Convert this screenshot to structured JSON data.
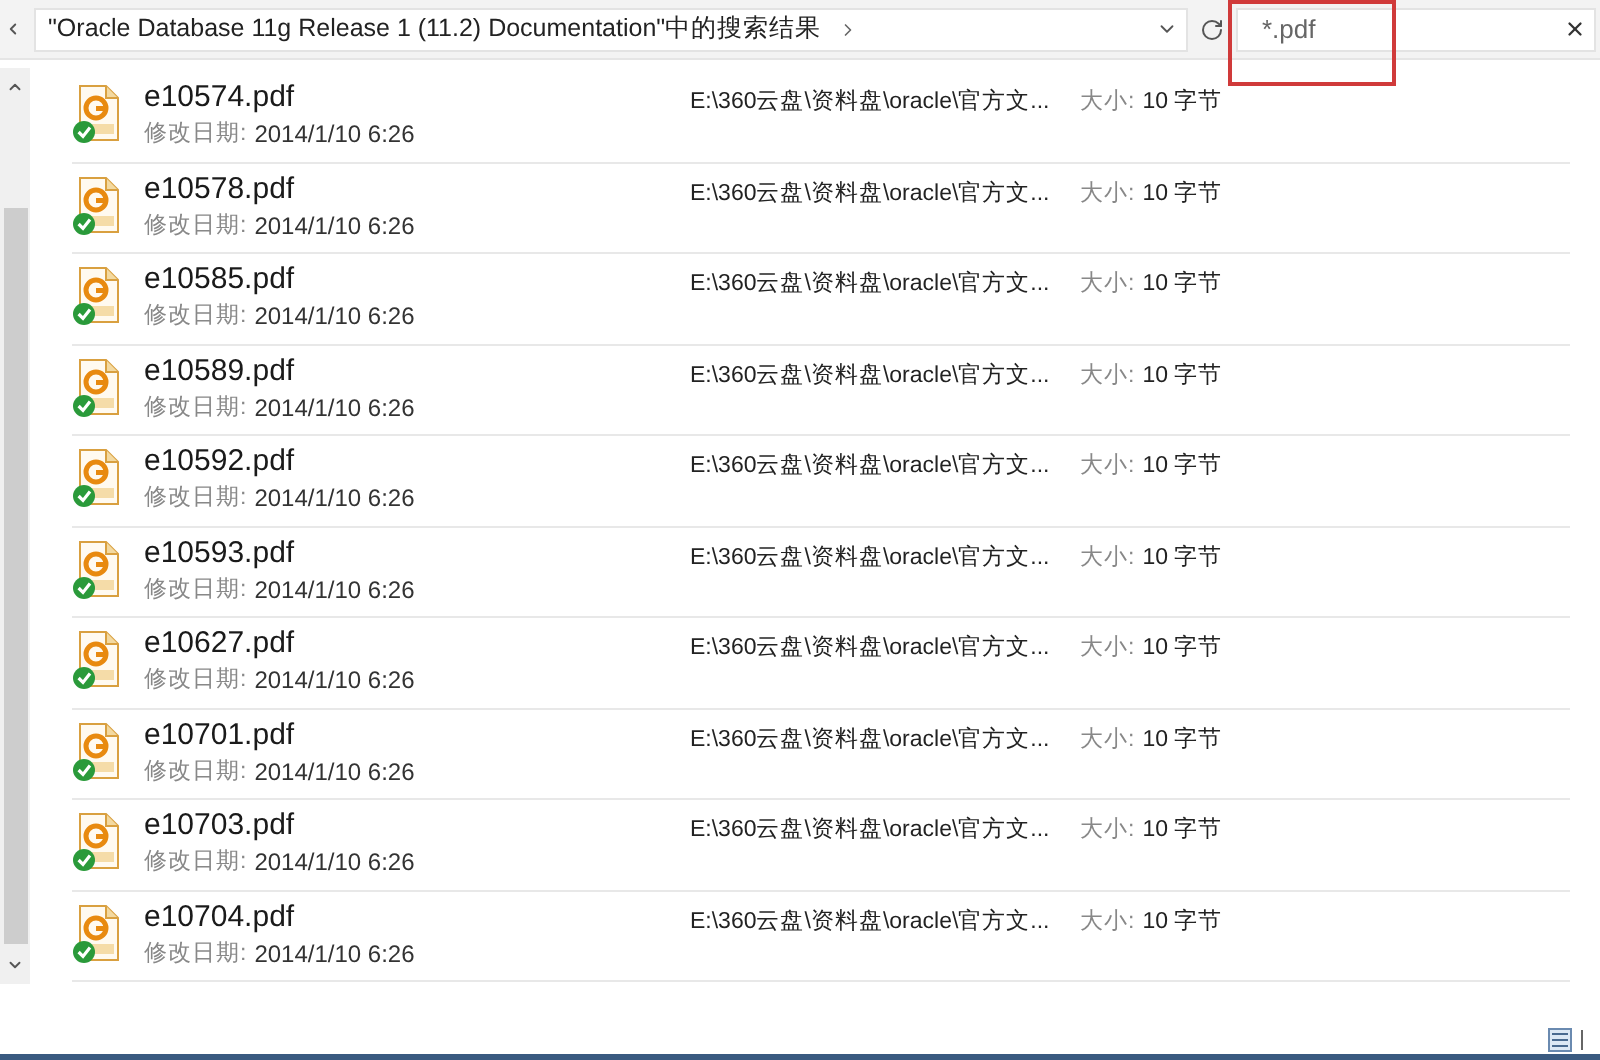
{
  "address_bar": {
    "path": "\"Oracle Database 11g Release 1 (11.2) Documentation\"中的搜索结果"
  },
  "search": {
    "value": "*.pdf",
    "highlighted": true
  },
  "files": [
    {
      "name": "e10574.pdf",
      "date_label": "修改日期:",
      "date": "2014/1/10 6:26",
      "path": "E:\\360云盘\\资料盘\\oracle\\官方文...",
      "size_label": "大小:",
      "size": "10 字节",
      "synced": true
    },
    {
      "name": "e10578.pdf",
      "date_label": "修改日期:",
      "date": "2014/1/10 6:26",
      "path": "E:\\360云盘\\资料盘\\oracle\\官方文...",
      "size_label": "大小:",
      "size": "10 字节",
      "synced": true
    },
    {
      "name": "e10585.pdf",
      "date_label": "修改日期:",
      "date": "2014/1/10 6:26",
      "path": "E:\\360云盘\\资料盘\\oracle\\官方文...",
      "size_label": "大小:",
      "size": "10 字节",
      "synced": true
    },
    {
      "name": "e10589.pdf",
      "date_label": "修改日期:",
      "date": "2014/1/10 6:26",
      "path": "E:\\360云盘\\资料盘\\oracle\\官方文...",
      "size_label": "大小:",
      "size": "10 字节",
      "synced": true
    },
    {
      "name": "e10592.pdf",
      "date_label": "修改日期:",
      "date": "2014/1/10 6:26",
      "path": "E:\\360云盘\\资料盘\\oracle\\官方文...",
      "size_label": "大小:",
      "size": "10 字节",
      "synced": true
    },
    {
      "name": "e10593.pdf",
      "date_label": "修改日期:",
      "date": "2014/1/10 6:26",
      "path": "E:\\360云盘\\资料盘\\oracle\\官方文...",
      "size_label": "大小:",
      "size": "10 字节",
      "synced": true
    },
    {
      "name": "e10627.pdf",
      "date_label": "修改日期:",
      "date": "2014/1/10 6:26",
      "path": "E:\\360云盘\\资料盘\\oracle\\官方文...",
      "size_label": "大小:",
      "size": "10 字节",
      "synced": true
    },
    {
      "name": "e10701.pdf",
      "date_label": "修改日期:",
      "date": "2014/1/10 6:26",
      "path": "E:\\360云盘\\资料盘\\oracle\\官方文...",
      "size_label": "大小:",
      "size": "10 字节",
      "synced": true
    },
    {
      "name": "e10703.pdf",
      "date_label": "修改日期:",
      "date": "2014/1/10 6:26",
      "path": "E:\\360云盘\\资料盘\\oracle\\官方文...",
      "size_label": "大小:",
      "size": "10 字节",
      "synced": true
    },
    {
      "name": "e10704.pdf",
      "date_label": "修改日期:",
      "date": "2014/1/10 6:26",
      "path": "E:\\360云盘\\资料盘\\oracle\\官方文...",
      "size_label": "大小:",
      "size": "10 字节",
      "synced": true
    }
  ]
}
